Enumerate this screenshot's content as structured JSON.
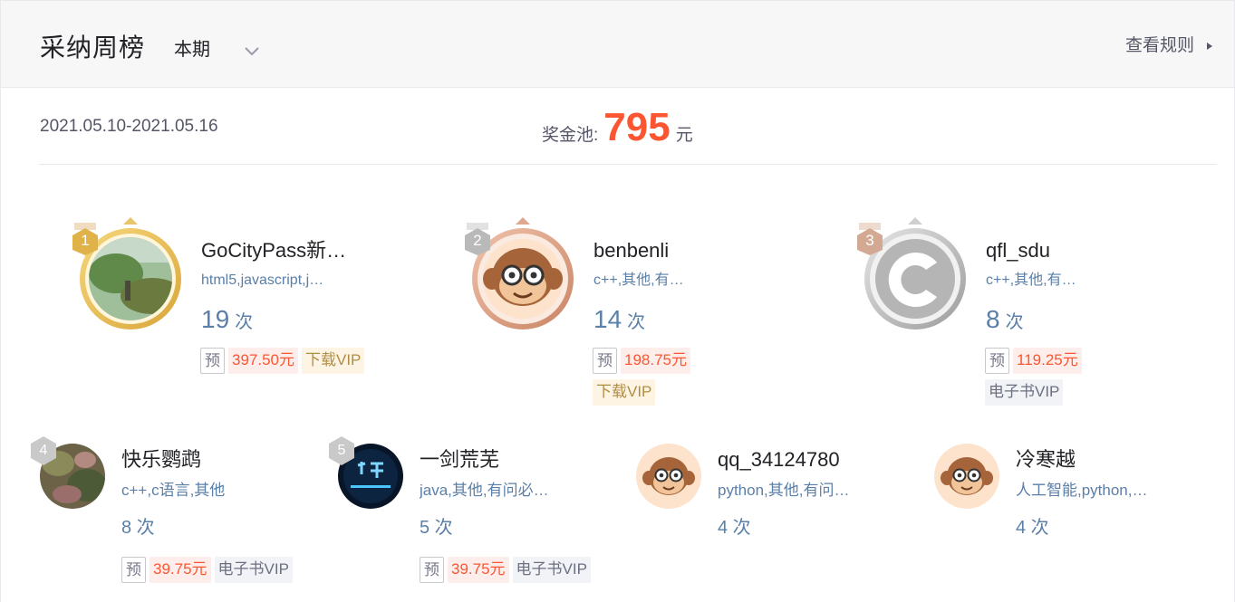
{
  "header": {
    "title": "采纳周榜",
    "period": "本期",
    "rules": "查看规则"
  },
  "summary": {
    "date_range": "2021.05.10-2021.05.16",
    "pool_label": "奖金池:",
    "pool_amount": "795",
    "pool_unit": "元"
  },
  "colors": {
    "accent": "#fc5531",
    "link_blue": "#5a7fa8",
    "gold": "#e0b24a",
    "bronze": "#d89b80",
    "silver": "#b8b8b8"
  },
  "top3": [
    {
      "rank": "1",
      "name": "GoCityPass新…",
      "tags": "html5,javascript,j…",
      "count": "19",
      "count_unit": "次",
      "badges": [
        {
          "type": "pre",
          "text": "预"
        },
        {
          "type": "money",
          "text": "397.50元"
        },
        {
          "type": "dl",
          "text": "下载VIP"
        }
      ]
    },
    {
      "rank": "2",
      "name": "benbenli",
      "tags": "c++,其他,有…",
      "count": "14",
      "count_unit": "次",
      "badges": [
        {
          "type": "pre",
          "text": "预"
        },
        {
          "type": "money",
          "text": "198.75元"
        },
        {
          "type": "dl",
          "text": "下载VIP"
        }
      ]
    },
    {
      "rank": "3",
      "name": "qfl_sdu",
      "tags": "c++,其他,有…",
      "count": "8",
      "count_unit": "次",
      "badges": [
        {
          "type": "pre",
          "text": "预"
        },
        {
          "type": "money",
          "text": "119.25元"
        },
        {
          "type": "ebook",
          "text": "电子书VIP"
        }
      ]
    }
  ],
  "others": [
    {
      "rank": "4",
      "name": "快乐鹦鹉",
      "tags": "c++,c语言,其他",
      "count": "8 次",
      "badges": [
        {
          "type": "pre",
          "text": "预"
        },
        {
          "type": "money",
          "text": "39.75元"
        },
        {
          "type": "ebook",
          "text": "电子书VIP"
        }
      ]
    },
    {
      "rank": "5",
      "name": "一剑荒芜",
      "tags": "java,其他,有问必…",
      "count": "5 次",
      "badges": [
        {
          "type": "pre",
          "text": "预"
        },
        {
          "type": "money",
          "text": "39.75元"
        },
        {
          "type": "ebook",
          "text": "电子书VIP"
        }
      ]
    },
    {
      "rank": "",
      "name": "qq_34124780",
      "tags": "python,其他,有问…",
      "count": "4 次",
      "badges": []
    },
    {
      "rank": "",
      "name": "冷寒越",
      "tags": "人工智能,python,…",
      "count": "4 次",
      "badges": []
    }
  ]
}
